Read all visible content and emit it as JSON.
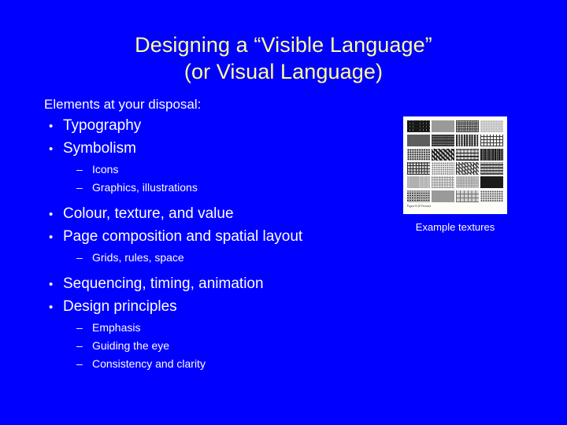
{
  "slide": {
    "background_color": "#0000FF",
    "title_color": "#FFFF99",
    "body_color": "#FFFFFF",
    "title": {
      "line1": "Designing a “Visible Language”",
      "line2": "(or Visual Language)"
    },
    "body": [
      {
        "level": 0,
        "marker": "",
        "text": "Elements at your disposal:"
      },
      {
        "level": 1,
        "marker": "•",
        "text": "Typography"
      },
      {
        "level": 1,
        "marker": "•",
        "text": "Symbolism"
      },
      {
        "level": 2,
        "marker": "–",
        "text": "Icons"
      },
      {
        "level": 2,
        "marker": "–",
        "text": "Graphics, illustrations"
      },
      {
        "level": 1,
        "marker": "•",
        "text": "Colour, texture, and value"
      },
      {
        "level": 1,
        "marker": "•",
        "text": "Page composition and spatial layout"
      },
      {
        "level": 2,
        "marker": "–",
        "text": "Grids, rules, space"
      },
      {
        "level": 1,
        "marker": "•",
        "text": "Sequencing, timing, animation"
      },
      {
        "level": 1,
        "marker": "•",
        "text": "Design principles"
      },
      {
        "level": 2,
        "marker": "–",
        "text": "Emphasis"
      },
      {
        "level": 2,
        "marker": "–",
        "text": "Guiding the eye"
      },
      {
        "level": 2,
        "marker": "–",
        "text": "Consistency and clarity"
      }
    ],
    "picture": {
      "caption": "Example textures",
      "figure_caption": "Figure 8.26 Textures",
      "grid_columns": 4,
      "grid_rows": 6,
      "swatch_count": 24
    }
  }
}
